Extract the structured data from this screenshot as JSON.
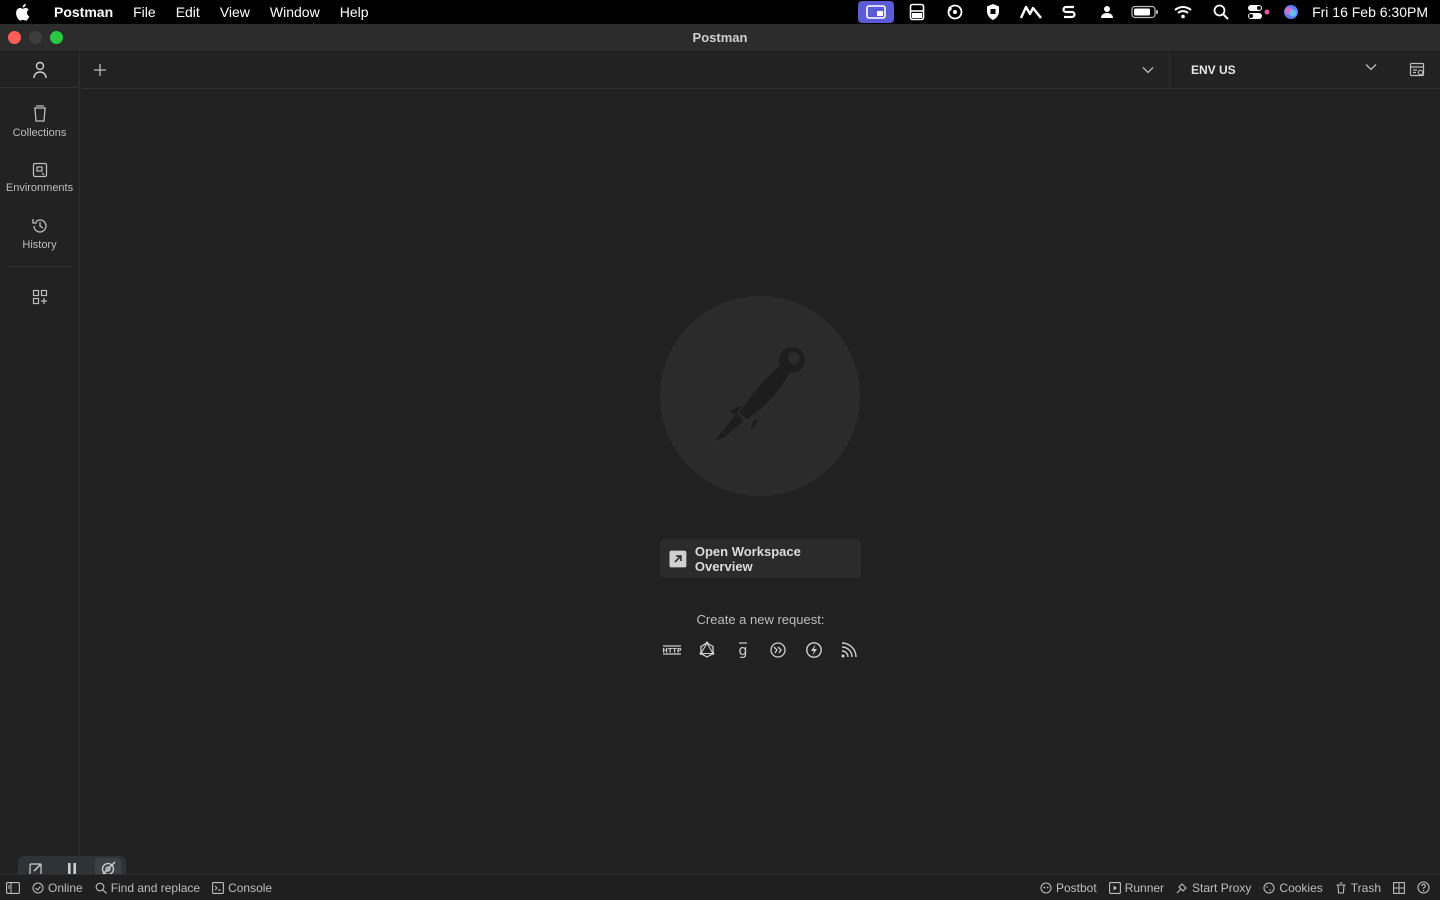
{
  "menubar": {
    "app_name": "Postman",
    "menus": [
      "File",
      "Edit",
      "View",
      "Window",
      "Help"
    ],
    "clock": "Fri 16 Feb  6:30PM",
    "active_color": "#5b5bd6"
  },
  "window": {
    "title": "Postman",
    "traffic_colors": [
      "#ff5f57",
      "#3d3d3d",
      "#28c840"
    ]
  },
  "sidebar": {
    "items": [
      {
        "label": "Collections",
        "icon": "trash-bin-collection-icon"
      },
      {
        "label": "Environments",
        "icon": "environment-icon"
      },
      {
        "label": "History",
        "icon": "history-icon"
      }
    ]
  },
  "tabbar": {
    "environment": "ENV US"
  },
  "main": {
    "overview_button": "Open Workspace Overview",
    "create_label": "Create a new request:",
    "request_types": [
      "http-icon",
      "graphql-icon",
      "grpc-icon",
      "websocket-icon",
      "socketio-icon",
      "mqtt-icon"
    ]
  },
  "statusbar": {
    "online": "Online",
    "find_replace": "Find and replace",
    "console": "Console",
    "postbot": "Postbot",
    "runner": "Runner",
    "start_proxy": "Start Proxy",
    "cookies": "Cookies",
    "trash": "Trash"
  }
}
